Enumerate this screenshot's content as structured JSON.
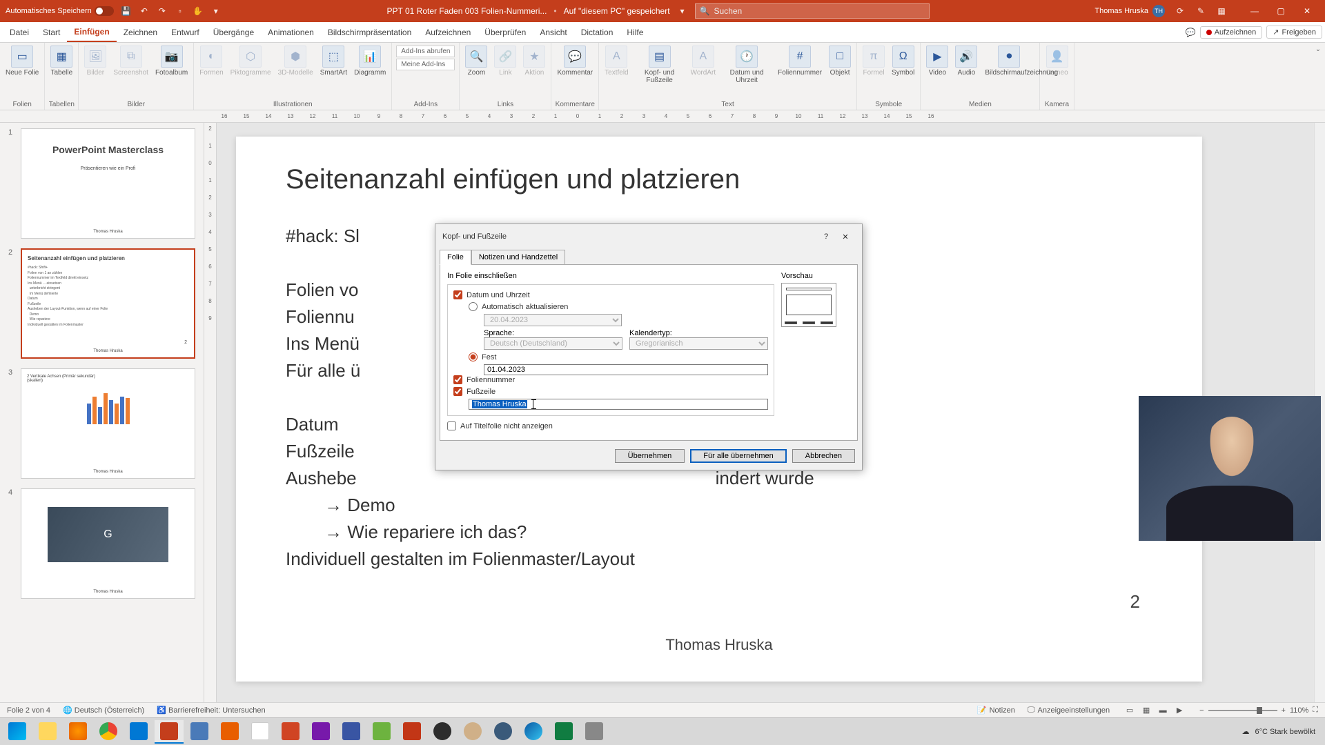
{
  "titlebar": {
    "autosave": "Automatisches Speichern",
    "filename": "PPT 01 Roter Faden 003 Folien-Nummeri...",
    "save_location": "Auf \"diesem PC\" gespeichert",
    "search_placeholder": "Suchen",
    "user_name": "Thomas Hruska",
    "user_initials": "TH"
  },
  "tabs": {
    "datei": "Datei",
    "start": "Start",
    "einfuegen": "Einfügen",
    "zeichnen": "Zeichnen",
    "entwurf": "Entwurf",
    "uebergaenge": "Übergänge",
    "animationen": "Animationen",
    "bildschirm": "Bildschirmpräsentation",
    "aufzeichnen": "Aufzeichnen",
    "ueberpruefen": "Überprüfen",
    "ansicht": "Ansicht",
    "dictation": "Dictation",
    "hilfe": "Hilfe",
    "aufzeichnen_btn": "Aufzeichnen",
    "freigeben": "Freigeben"
  },
  "ribbon": {
    "groups": {
      "folien": "Folien",
      "tabellen": "Tabellen",
      "bilder": "Bilder",
      "illustrationen": "Illustrationen",
      "addins": "Add-Ins",
      "links": "Links",
      "kommentare": "Kommentare",
      "text": "Text",
      "symbole": "Symbole",
      "medien": "Medien",
      "kamera": "Kamera"
    },
    "buttons": {
      "neue_folie": "Neue Folie",
      "tabelle": "Tabelle",
      "bilder": "Bilder",
      "screenshot": "Screenshot",
      "fotoalbum": "Fotoalbum",
      "formen": "Formen",
      "piktogramme": "Piktogramme",
      "3d": "3D-Modelle",
      "smartart": "SmartArt",
      "diagramm": "Diagramm",
      "addins_get": "Add-Ins abrufen",
      "addins_my": "Meine Add-Ins",
      "zoom": "Zoom",
      "link": "Link",
      "aktion": "Aktion",
      "kommentar": "Kommentar",
      "textfeld": "Textfeld",
      "kopf_fuss": "Kopf- und Fußzeile",
      "wordart": "WordArt",
      "datum": "Datum und Uhrzeit",
      "foliennummer": "Foliennummer",
      "objekt": "Objekt",
      "formel": "Formel",
      "symbol": "Symbol",
      "video": "Video",
      "audio": "Audio",
      "bildschirmaufz": "Bildschirmaufzeichnung",
      "cameo": "Cameo"
    }
  },
  "ruler": [
    "16",
    "15",
    "14",
    "13",
    "12",
    "11",
    "10",
    "9",
    "8",
    "7",
    "6",
    "5",
    "4",
    "3",
    "2",
    "1",
    "0",
    "1",
    "2",
    "3",
    "4",
    "5",
    "6",
    "7",
    "8",
    "9",
    "10",
    "11",
    "12",
    "13",
    "14",
    "15",
    "16"
  ],
  "ruler_v": [
    "2",
    "1",
    "0",
    "1",
    "2",
    "3",
    "4",
    "5",
    "6",
    "7",
    "8",
    "9"
  ],
  "thumbnails": {
    "s1": {
      "title": "PowerPoint Masterclass",
      "subtitle": "Präsentieren wie ein Profi",
      "author": "Thomas Hruska"
    },
    "s2": {
      "title": "Seitenanzahl einfügen und platzieren",
      "author": "Thomas Hruska",
      "page": "2"
    },
    "s3": {
      "author": "Thomas Hruska"
    },
    "s4": {
      "author": "Thomas Hruska"
    }
  },
  "slide": {
    "title": "Seitenanzahl einfügen und platzieren",
    "hack": "#hack: Sl",
    "l1": "Folien vo",
    "l2": "Foliennu",
    "l3": "Ins Menü",
    "l4": "Für alle ü",
    "l5": "Datum",
    "l6": "Fußzeile",
    "l7a": "Aushebe",
    "l7b": "indert wurde",
    "l8": "Demo",
    "l9": "Wie repariere ich das?",
    "l10": "Individuell gestalten im Folienmaster/Layout",
    "footer": "Thomas Hruska",
    "pagenum": "2"
  },
  "dialog": {
    "title": "Kopf- und Fußzeile",
    "tab_folie": "Folie",
    "tab_notizen": "Notizen und Handzettel",
    "group_label": "In Folie einschließen",
    "datum": "Datum und Uhrzeit",
    "auto": "Automatisch aktualisieren",
    "date_auto": "20.04.2023",
    "sprache": "Sprache:",
    "sprache_val": "Deutsch (Deutschland)",
    "kalendertyp": "Kalendertyp:",
    "kalender_val": "Gregorianisch",
    "fest": "Fest",
    "date_fixed": "01.04.2023",
    "foliennummer": "Foliennummer",
    "fusszeile": "Fußzeile",
    "fusszeile_val": "Thomas Hruska",
    "titelfolie": "Auf Titelfolie nicht anzeigen",
    "vorschau": "Vorschau",
    "btn_apply": "Übernehmen",
    "btn_apply_all": "Für alle übernehmen",
    "btn_cancel": "Abbrechen"
  },
  "statusbar": {
    "slide_info": "Folie 2 von 4",
    "lang": "Deutsch (Österreich)",
    "accessibility": "Barrierefreiheit: Untersuchen",
    "notes": "Notizen",
    "display": "Anzeigeeinstellungen",
    "zoom": "110%"
  },
  "taskbar": {
    "weather": "6°C  Stark bewölkt"
  }
}
